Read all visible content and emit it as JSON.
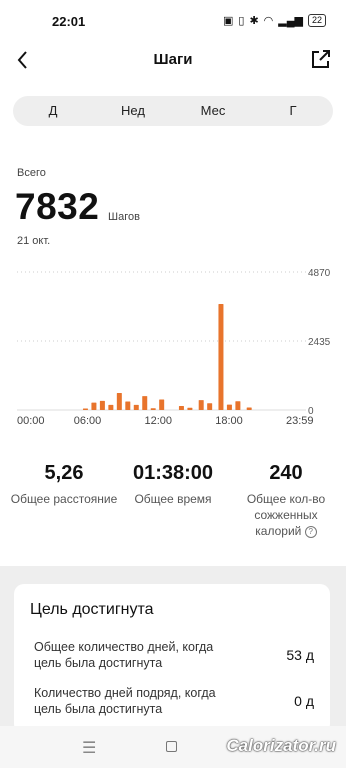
{
  "status_bar": {
    "time": "22:01",
    "battery": "22"
  },
  "header": {
    "title": "Шаги"
  },
  "tabs": [
    {
      "label": "Д",
      "active": true
    },
    {
      "label": "Нед",
      "active": false
    },
    {
      "label": "Мес",
      "active": false
    },
    {
      "label": "Г",
      "active": false
    }
  ],
  "summary": {
    "total_label": "Всего",
    "total_value": "7832",
    "unit": "Шагов",
    "date": "21 окт."
  },
  "chart_data": {
    "type": "bar",
    "bar_color": "#e8742c",
    "x_tick_labels": [
      "00:00",
      "06:00",
      "12:00",
      "18:00",
      "23:59"
    ],
    "y_tick_labels": [
      "4870",
      "2435",
      "0"
    ],
    "ylim": [
      0,
      4870
    ],
    "grid": true,
    "points": [
      {
        "hour": 5.0,
        "value": 40
      },
      {
        "hour": 5.75,
        "value": 260
      },
      {
        "hour": 6.5,
        "value": 320
      },
      {
        "hour": 7.25,
        "value": 180
      },
      {
        "hour": 8.0,
        "value": 600
      },
      {
        "hour": 8.75,
        "value": 300
      },
      {
        "hour": 9.5,
        "value": 180
      },
      {
        "hour": 10.25,
        "value": 490
      },
      {
        "hour": 11.0,
        "value": 60
      },
      {
        "hour": 11.75,
        "value": 370
      },
      {
        "hour": 13.5,
        "value": 140
      },
      {
        "hour": 14.25,
        "value": 80
      },
      {
        "hour": 15.25,
        "value": 350
      },
      {
        "hour": 16.0,
        "value": 240
      },
      {
        "hour": 17.0,
        "value": 3740
      },
      {
        "hour": 17.75,
        "value": 190
      },
      {
        "hour": 18.5,
        "value": 310
      },
      {
        "hour": 19.5,
        "value": 90
      }
    ]
  },
  "stats": [
    {
      "value": "5,26",
      "label": "Общее расстояние"
    },
    {
      "value": "01:38:00",
      "label": "Общее время"
    },
    {
      "value": "240",
      "label_line1": "Общее кол-во",
      "label_line2": "сожженных",
      "label_line3": "калорий"
    }
  ],
  "goal": {
    "title": "Цель достигнута",
    "rows": [
      {
        "label_line1": "Общее количество дней, когда",
        "label_line2": "цель была достигнута",
        "value": "53 д"
      },
      {
        "label_line1": "Количество дней подряд, когда",
        "label_line2": "цель была достигнута",
        "value": "0 д"
      }
    ]
  },
  "watermark": "Calorizator.ru"
}
